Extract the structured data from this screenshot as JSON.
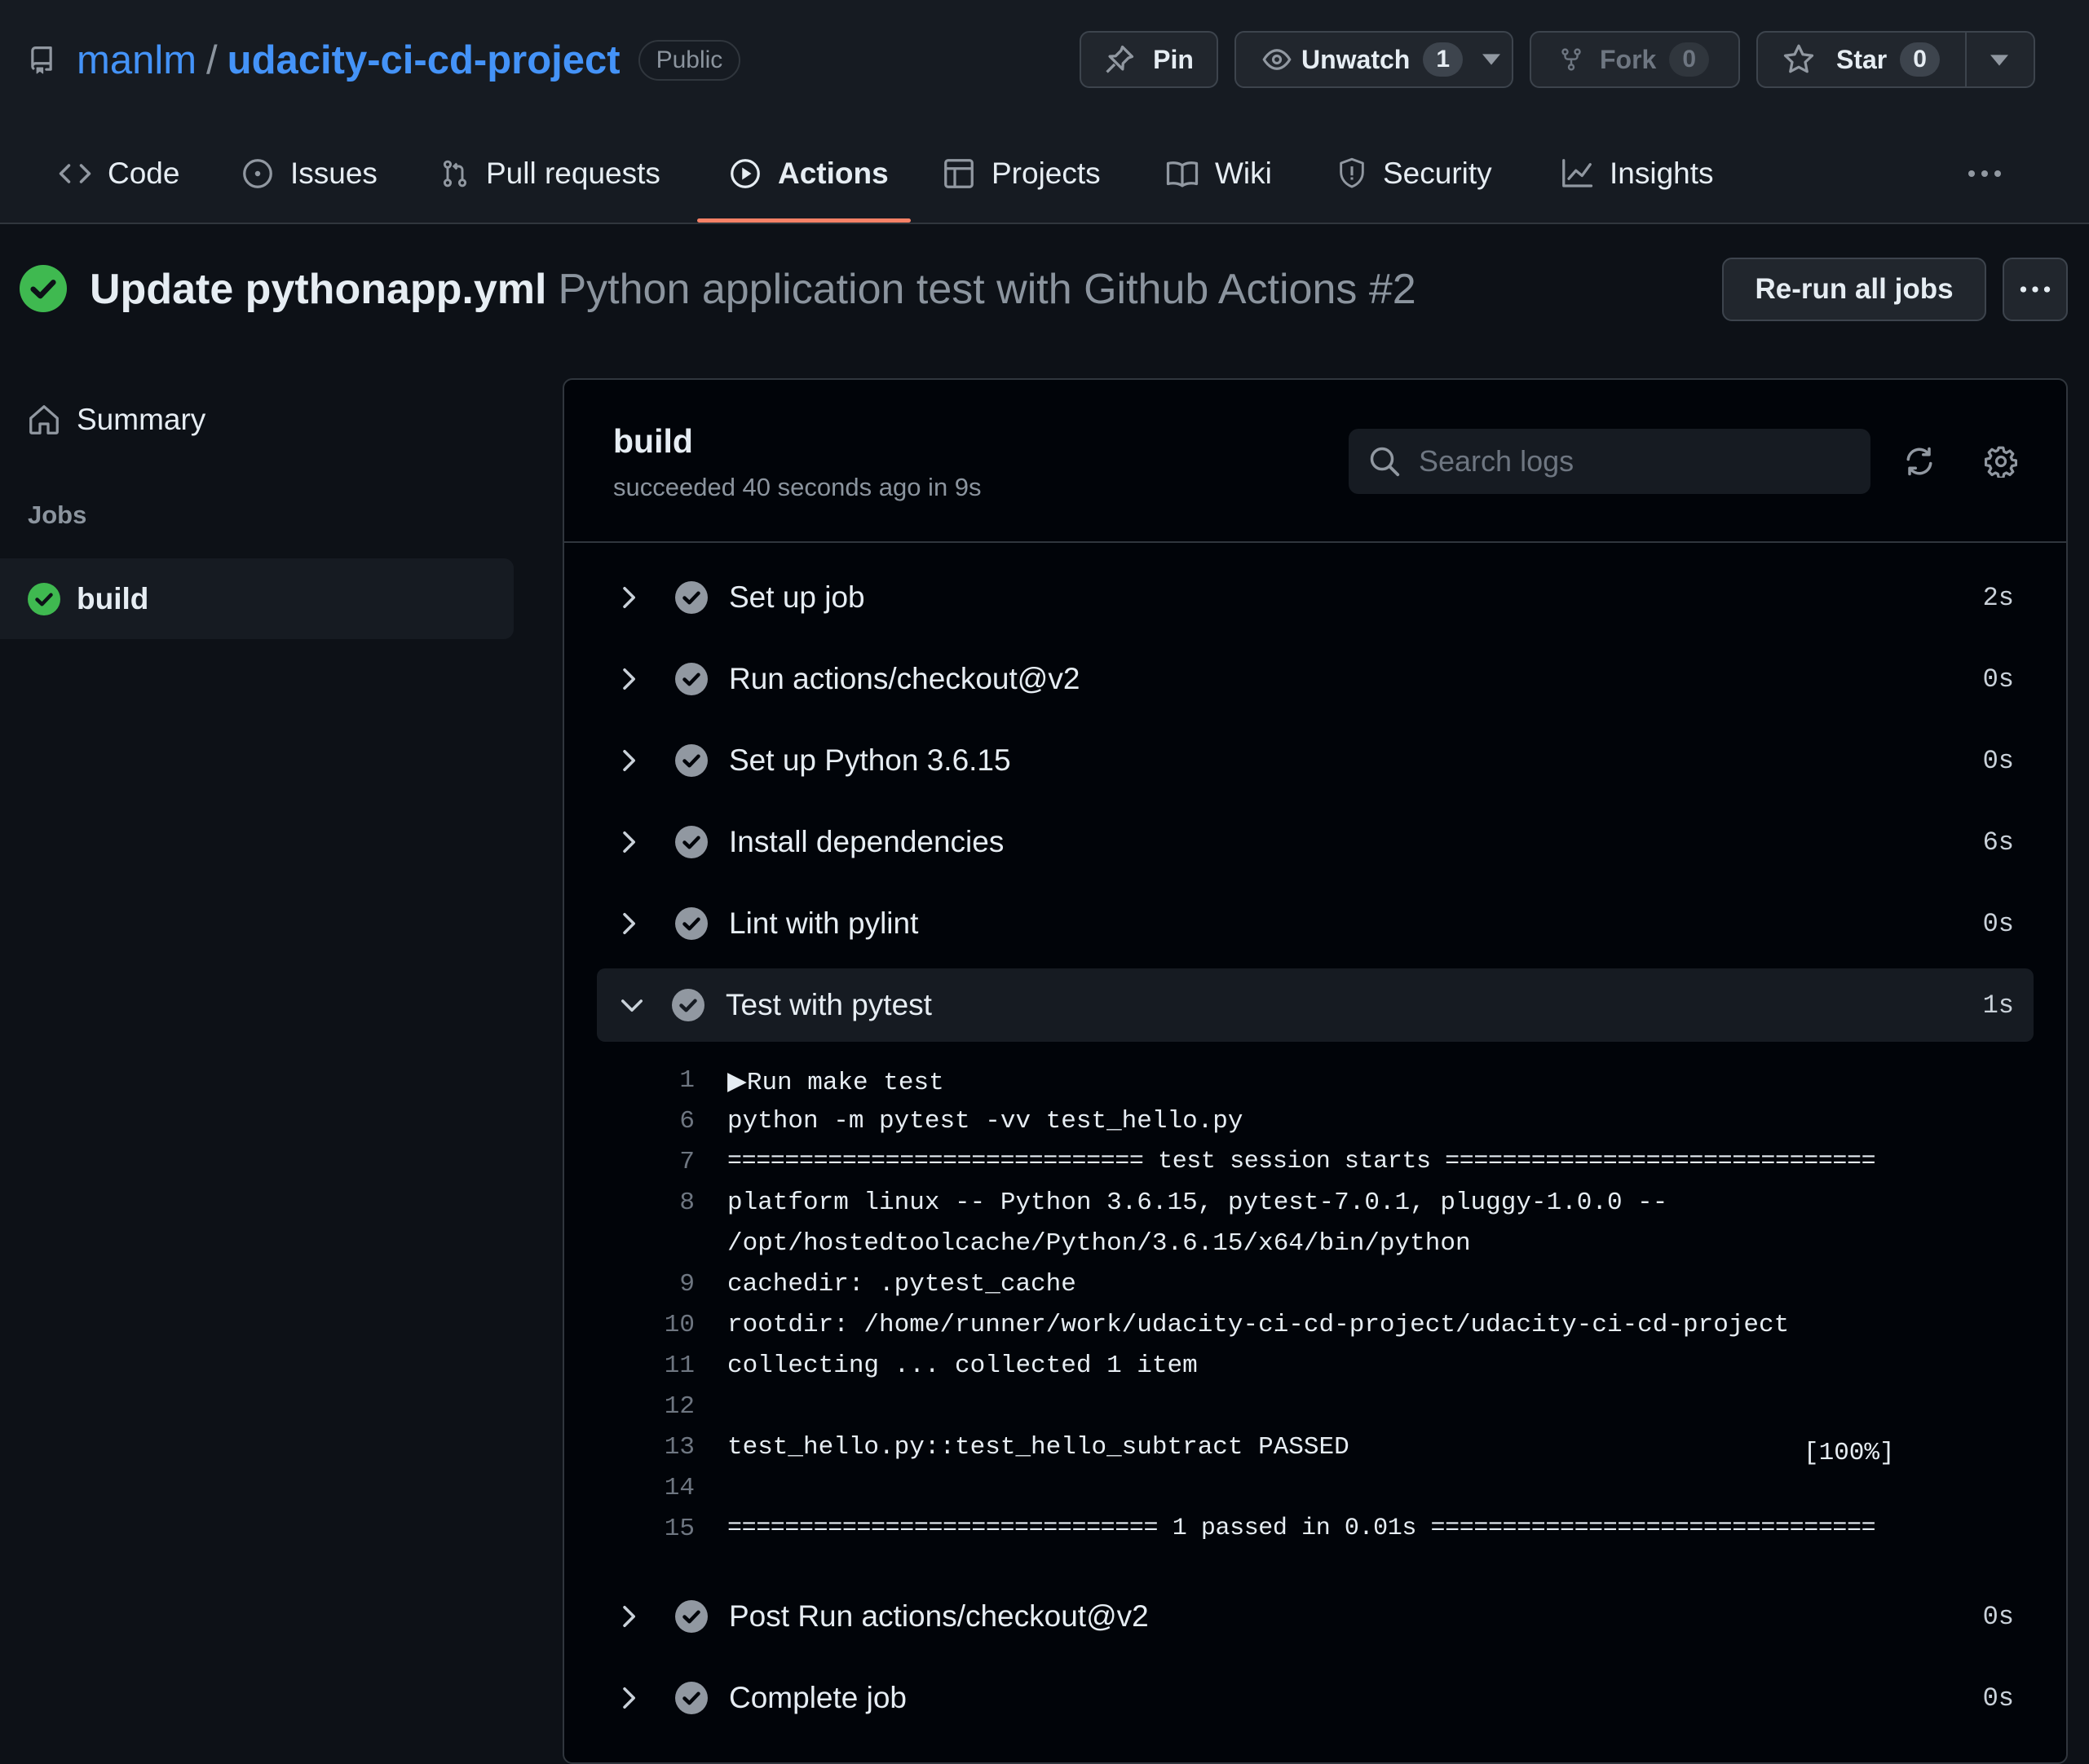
{
  "repo": {
    "owner": "manlm",
    "separator": "/",
    "name": "udacity-ci-cd-project",
    "visibility": "Public"
  },
  "header_buttons": {
    "pin": {
      "label": "Pin"
    },
    "unwatch": {
      "label": "Unwatch",
      "count": "1"
    },
    "fork": {
      "label": "Fork",
      "count": "0"
    },
    "star": {
      "label": "Star",
      "count": "0"
    }
  },
  "nav": {
    "tabs": [
      {
        "label": "Code",
        "icon": "code-icon"
      },
      {
        "label": "Issues",
        "icon": "issue-icon"
      },
      {
        "label": "Pull requests",
        "icon": "pull-request-icon"
      },
      {
        "label": "Actions",
        "icon": "play-icon",
        "selected": true
      },
      {
        "label": "Projects",
        "icon": "table-icon"
      },
      {
        "label": "Wiki",
        "icon": "book-icon"
      },
      {
        "label": "Security",
        "icon": "shield-icon"
      },
      {
        "label": "Insights",
        "icon": "graph-icon"
      }
    ]
  },
  "run": {
    "commit_title": "Update pythonapp.yml",
    "workflow_title": "Python application test with Github Actions #2",
    "rerun_label": "Re-run all jobs",
    "status_color": "#3fb950"
  },
  "sidebar": {
    "summary_label": "Summary",
    "jobs_heading": "Jobs",
    "job_label": "build"
  },
  "job": {
    "name": "build",
    "status_text": "succeeded 40 seconds ago in 9s",
    "search_placeholder": "Search logs"
  },
  "steps": [
    {
      "name": "Set up job",
      "duration": "2s"
    },
    {
      "name": "Run actions/checkout@v2",
      "duration": "0s"
    },
    {
      "name": "Set up Python 3.6.15",
      "duration": "0s"
    },
    {
      "name": "Install dependencies",
      "duration": "6s"
    },
    {
      "name": "Lint with pylint",
      "duration": "0s"
    },
    {
      "name": "Test with pytest",
      "duration": "1s",
      "expanded": true
    },
    {
      "name": "Post Run actions/checkout@v2",
      "duration": "0s"
    },
    {
      "name": "Complete job",
      "duration": "0s"
    }
  ],
  "log": {
    "lines": [
      {
        "num": "1",
        "text": "▶Run make test"
      },
      {
        "num": "6",
        "text": "python -m pytest -vv test_hello.py"
      },
      {
        "num": "7",
        "text": "============================= test session starts =============================="
      },
      {
        "num": "8",
        "text": "platform linux -- Python 3.6.15, pytest-7.0.1, pluggy-1.0.0 --"
      },
      {
        "num": "9",
        "text": "cachedir: .pytest_cache"
      },
      {
        "num": "10",
        "text": "rootdir: /home/runner/work/udacity-ci-cd-project/udacity-ci-cd-project"
      },
      {
        "num": "11",
        "text": "collecting ... collected 1 item"
      },
      {
        "num": "12",
        "text": ""
      },
      {
        "num": "13",
        "text": "test_hello.py::test_hello_subtract PASSED"
      },
      {
        "num": "14",
        "text": ""
      },
      {
        "num": "15",
        "text": "============================== 1 passed in 0.01s ==============================="
      }
    ],
    "line8_continuation": "/opt/hostedtoolcache/Python/3.6.15/x64/bin/python",
    "line13_progress": "[100%]"
  }
}
